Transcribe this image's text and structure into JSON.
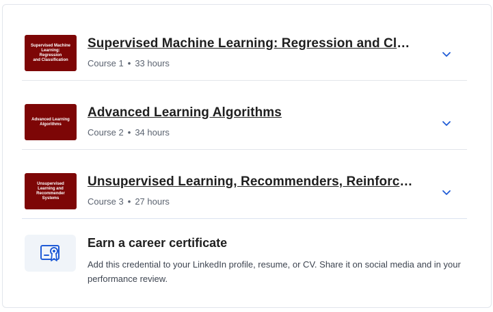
{
  "courses": [
    {
      "thumb_text": "Supervised Machine\nLearning:\nRegression\nand Classification",
      "title": "Supervised Machine Learning: Regression and Classifi…",
      "course_label": "Course 1",
      "separator": "•",
      "hours": "33 hours"
    },
    {
      "thumb_text": "Advanced Learning\nAlgorithms",
      "title": "Advanced Learning Algorithms",
      "course_label": "Course 2",
      "separator": "•",
      "hours": "34 hours"
    },
    {
      "thumb_text": "Unsupervised\nLearning and\nRecommender\nSystems",
      "title": "Unsupervised Learning, Recommenders, Reinforceme…",
      "course_label": "Course 3",
      "separator": "•",
      "hours": "27 hours"
    }
  ],
  "certificate": {
    "title": "Earn a career certificate",
    "description": "Add this credential to your LinkedIn profile, resume, or CV. Share it on social media and in your performance review.",
    "icon": "certificate-icon"
  },
  "colors": {
    "thumb_bg": "#7d0606",
    "chevron": "#1f5bd6",
    "icon_blue": "#1f5bd6",
    "icon_bg": "#f0f4f9"
  },
  "icons": {
    "chevron": "chevron-down-icon"
  }
}
